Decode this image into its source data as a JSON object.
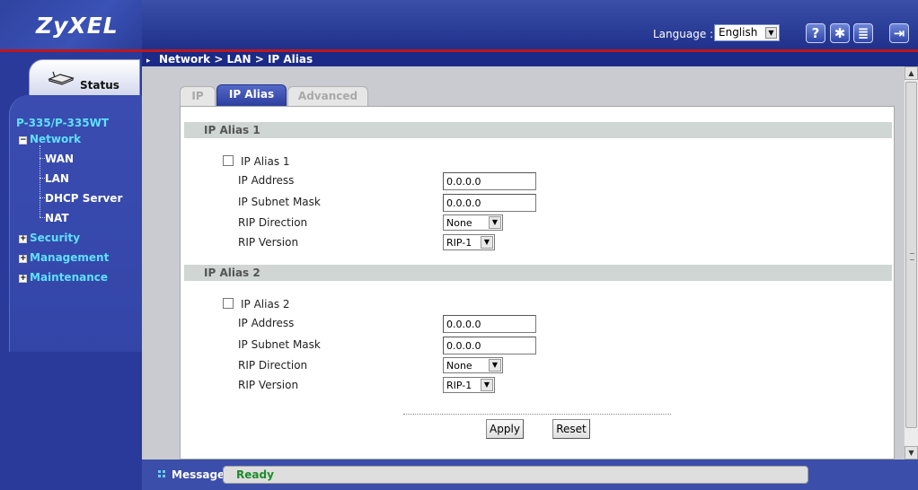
{
  "header": {
    "logo": "ZyXEL",
    "language_label": "Language :",
    "language_value": "English",
    "buttons": [
      {
        "icon": "help-icon",
        "glyph": "?"
      },
      {
        "icon": "wizard-icon",
        "glyph": "✱"
      },
      {
        "icon": "sitemap-icon",
        "glyph": "≣"
      },
      {
        "icon": "logout-icon",
        "glyph": "⇥"
      }
    ]
  },
  "sidebar": {
    "status_label": "Status",
    "model": "P-335/P-335WT",
    "menu": [
      {
        "label": "Network",
        "toggle": "−"
      },
      {
        "label": "Security",
        "toggle": "+"
      },
      {
        "label": "Management",
        "toggle": "+"
      },
      {
        "label": "Maintenance",
        "toggle": "+"
      }
    ],
    "network_items": [
      "WAN",
      "LAN",
      "DHCP Server",
      "NAT"
    ]
  },
  "breadcrumb": "Network > LAN > IP Alias",
  "tabs": [
    "IP",
    "IP Alias",
    "Advanced"
  ],
  "sections": [
    {
      "heading": "IP Alias 1",
      "checkbox_label": "IP Alias 1",
      "ip_address_label": "IP Address",
      "ip_address_value": "0.0.0.0",
      "subnet_label": "IP Subnet Mask",
      "subnet_value": "0.0.0.0",
      "rip_direction_label": "RIP Direction",
      "rip_direction_value": "None",
      "rip_version_label": "RIP Version",
      "rip_version_value": "RIP-1"
    },
    {
      "heading": "IP Alias 2",
      "checkbox_label": "IP Alias 2",
      "ip_address_label": "IP Address",
      "ip_address_value": "0.0.0.0",
      "subnet_label": "IP Subnet Mask",
      "subnet_value": "0.0.0.0",
      "rip_direction_label": "RIP Direction",
      "rip_direction_value": "None",
      "rip_version_label": "RIP Version",
      "rip_version_value": "RIP-1"
    }
  ],
  "actions": {
    "apply": "Apply",
    "reset": "Reset"
  },
  "message": {
    "label": "Message",
    "value": "Ready"
  },
  "colors": {
    "accent_blue": "#2a3a9a",
    "header_red": "#c0161c",
    "status_green": "#1c8c2a",
    "menu_cyan": "#5ee0ff"
  }
}
